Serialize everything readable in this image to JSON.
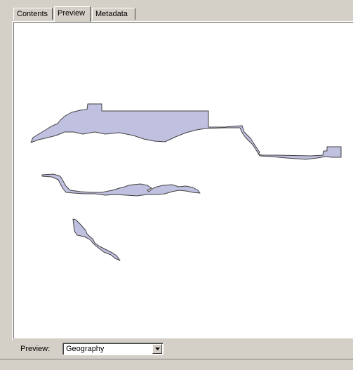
{
  "tabs": [
    {
      "label": "Contents",
      "active": false
    },
    {
      "label": "Preview",
      "active": true
    },
    {
      "label": "Metadata",
      "active": false
    }
  ],
  "preview": {
    "label": "Preview:",
    "selected_value": "Geography",
    "dropdown_icon": "chevron-down-icon"
  },
  "map": {
    "feature_fill": "#c0c0e0",
    "feature_stroke": "#404040",
    "background": "#ffffff"
  }
}
